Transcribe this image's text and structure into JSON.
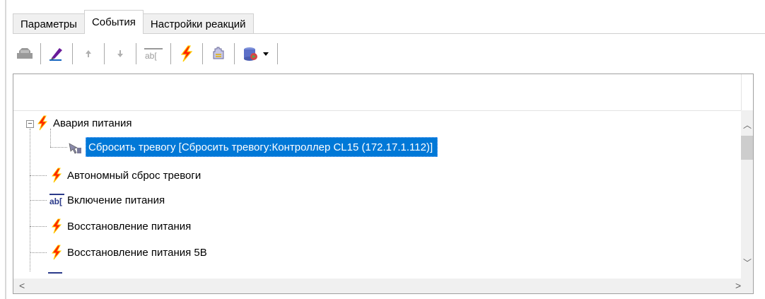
{
  "tabs": [
    "Параметры",
    "События",
    "Настройки реакций"
  ],
  "tree": {
    "root": "Авария питания",
    "child": "Сбросить тревогу [Сбросить тревогу:Контроллер CL15 (172.17.1.112)]",
    "items": [
      "Автономный сброс тревоги",
      "Включение питания",
      "Восстановление питания",
      "Восстановление питания 5В"
    ]
  }
}
